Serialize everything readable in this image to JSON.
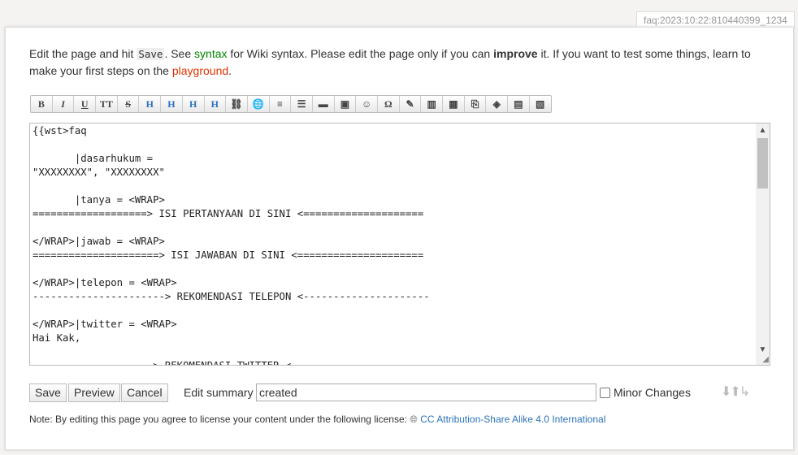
{
  "page_id": "faq:2023:10:22:810440399_1234",
  "intro": {
    "t1": "Edit the page and hit ",
    "save_code": "Save",
    "t2": ". See ",
    "syntax_link": "syntax",
    "t3": " for Wiki syntax. Please edit the page only if you can ",
    "improve": "improve",
    "t4": " it. If you want to test some things, learn to make your first steps on the ",
    "playground_link": "playground",
    "t5": "."
  },
  "toolbar": [
    {
      "icon": "bold-icon",
      "glyph": "B"
    },
    {
      "icon": "italic-icon",
      "glyph": "I"
    },
    {
      "icon": "underline-icon",
      "glyph": "U"
    },
    {
      "icon": "monospace-icon",
      "glyph": "TT"
    },
    {
      "icon": "strikethrough-icon",
      "glyph": "S"
    },
    {
      "icon": "heading-same-icon",
      "glyph": "H"
    },
    {
      "icon": "heading-lower-icon",
      "glyph": "H"
    },
    {
      "icon": "heading-higher-icon",
      "glyph": "H"
    },
    {
      "icon": "heading-select-icon",
      "glyph": "H"
    },
    {
      "icon": "internal-link-icon",
      "glyph": "⛓"
    },
    {
      "icon": "external-link-icon",
      "glyph": "🌐"
    },
    {
      "icon": "ordered-list-icon",
      "glyph": "≡"
    },
    {
      "icon": "unordered-list-icon",
      "glyph": "☰"
    },
    {
      "icon": "horizontal-rule-icon",
      "glyph": "▬"
    },
    {
      "icon": "image-icon",
      "glyph": "▣"
    },
    {
      "icon": "smiley-icon",
      "glyph": "☺"
    },
    {
      "icon": "special-chars-icon",
      "glyph": "Ω"
    },
    {
      "icon": "signature-icon",
      "glyph": "✎"
    },
    {
      "icon": "column-icon",
      "glyph": "▥"
    },
    {
      "icon": "table-icon",
      "glyph": "▦"
    },
    {
      "icon": "clip-icon",
      "glyph": "⎘"
    },
    {
      "icon": "box-icon",
      "glyph": "◈"
    },
    {
      "icon": "folder-icon",
      "glyph": "▤"
    },
    {
      "icon": "clapper-icon",
      "glyph": "▧"
    }
  ],
  "editor": {
    "content": "{{wst>faq\n\n       |dasarhukum =\n\"XXXXXXXX\", \"XXXXXXXX\"\n\n       |tanya = <WRAP>\n===================> ISI PERTANYAAN DI SINI <====================\n\n</WRAP>|jawab = <WRAP>\n=====================> ISI JAWABAN DI SINI <=====================\n\n</WRAP>|telepon = <WRAP>\n----------------------> REKOMENDASI TELEPON <---------------------\n\n</WRAP>|twitter = <WRAP>\nHai Kak,\n\n                    > REKOMENDASI TWITTER <"
  },
  "buttons": {
    "save": "Save",
    "preview": "Preview",
    "cancel": "Cancel"
  },
  "summary": {
    "label": "Edit summary",
    "value": "created"
  },
  "minor": {
    "label": "Minor Changes",
    "checked": false
  },
  "license": {
    "note": "Note: By editing this page you agree to license your content under the following license: ",
    "link": "CC Attribution-Share Alike 4.0 International"
  }
}
